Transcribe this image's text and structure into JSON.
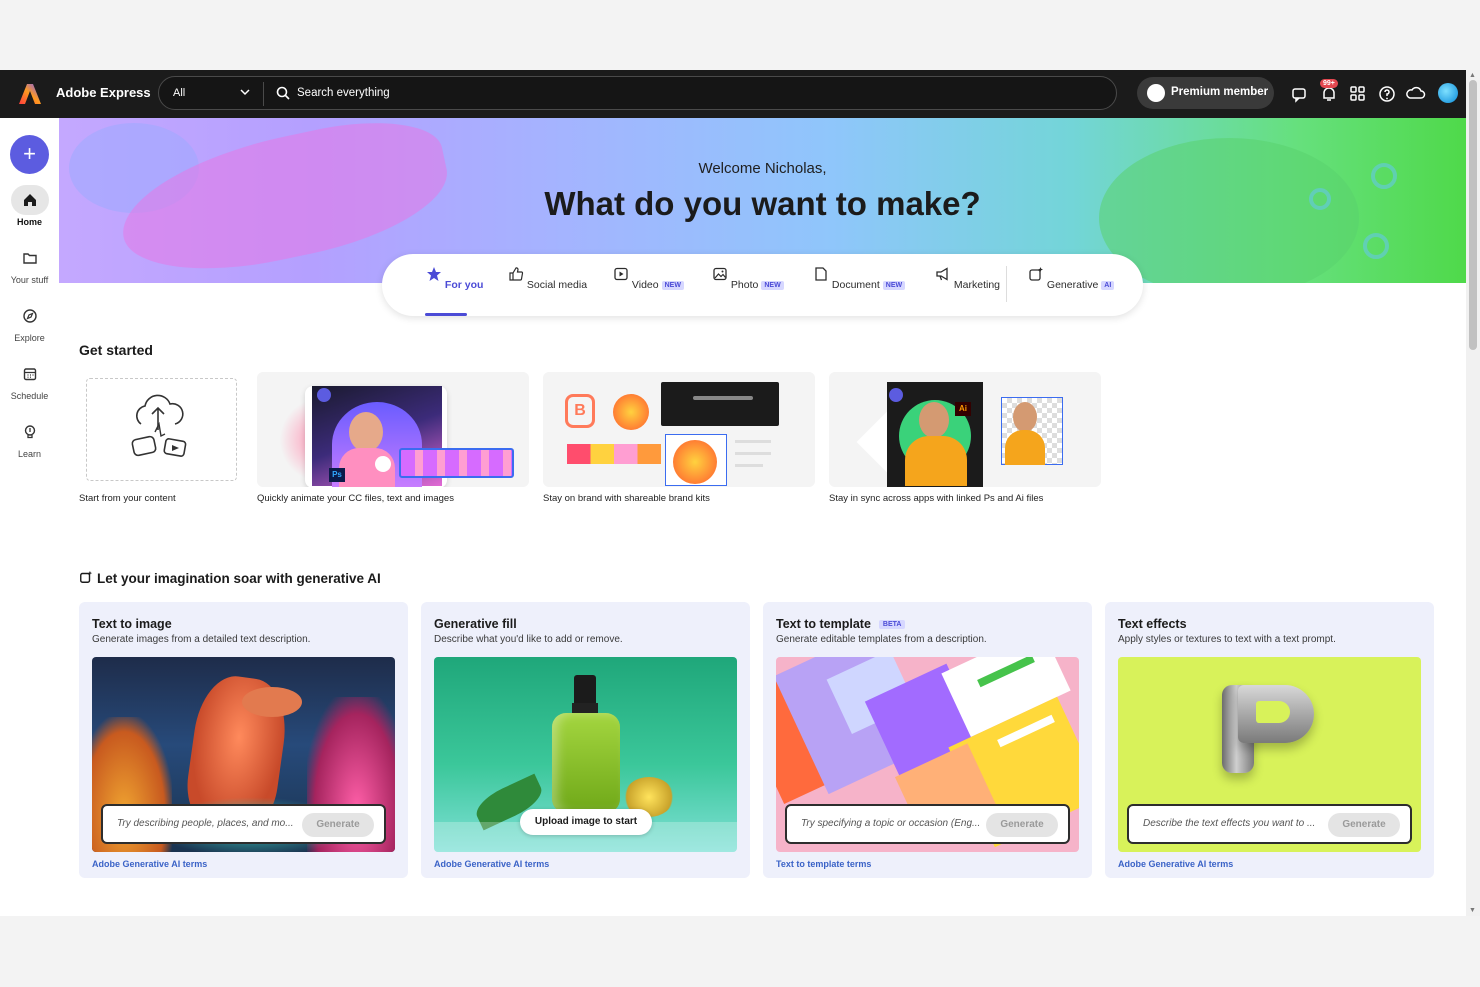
{
  "app": {
    "brand": "Adobe Express"
  },
  "search": {
    "scope": "All",
    "placeholder": "Search everything"
  },
  "header": {
    "premium_label": "Premium member",
    "notification_badge": "99+"
  },
  "rail": {
    "items": [
      {
        "label": "Home",
        "icon": "home-icon",
        "active": true
      },
      {
        "label": "Your stuff",
        "icon": "folder-icon",
        "active": false
      },
      {
        "label": "Explore",
        "icon": "compass-icon",
        "active": false
      },
      {
        "label": "Schedule",
        "icon": "calendar-icon",
        "active": false
      },
      {
        "label": "Learn",
        "icon": "lightbulb-icon",
        "active": false
      }
    ]
  },
  "hero": {
    "welcome": "Welcome Nicholas,",
    "headline": "What do you want to make?"
  },
  "tabs": [
    {
      "label": "For you",
      "badge": "",
      "icon": "star-icon",
      "active": true
    },
    {
      "label": "Social media",
      "badge": "",
      "icon": "thumbs-up-icon"
    },
    {
      "label": "Video",
      "badge": "NEW",
      "icon": "play-icon"
    },
    {
      "label": "Photo",
      "badge": "NEW",
      "icon": "image-icon"
    },
    {
      "label": "Document",
      "badge": "NEW",
      "icon": "document-icon"
    },
    {
      "label": "Marketing",
      "badge": "",
      "icon": "megaphone-icon"
    },
    {
      "label": "Generative",
      "badge": "AI",
      "icon": "generative-ai-icon"
    }
  ],
  "get_started": {
    "title": "Get started",
    "cards": [
      {
        "caption": "Start from your content"
      },
      {
        "caption": "Quickly animate your CC files, text and images"
      },
      {
        "caption": "Stay on brand with shareable brand kits"
      },
      {
        "caption": "Stay in sync across apps with linked Ps and Ai files"
      }
    ]
  },
  "generative": {
    "title": "Let your imagination soar with generative AI",
    "cards": [
      {
        "title": "Text to image",
        "badge": "",
        "description": "Generate images from a detailed text description.",
        "placeholder": "Try describing people, places, and mo...",
        "button": "Generate",
        "terms": "Adobe Generative AI terms"
      },
      {
        "title": "Generative fill",
        "badge": "",
        "description": "Describe what you'd like to add or remove.",
        "button": "Upload image to start",
        "terms": "Adobe Generative AI terms"
      },
      {
        "title": "Text to template",
        "badge": "BETA",
        "description": "Generate editable templates from a description.",
        "placeholder": "Try specifying a topic or occasion (Eng...",
        "button": "Generate",
        "terms": "Text to template terms"
      },
      {
        "title": "Text effects",
        "badge": "",
        "description": "Apply styles or textures to text with a text prompt.",
        "placeholder": "Describe the text effects you want to ...",
        "button": "Generate",
        "terms": "Adobe Generative AI terms"
      }
    ]
  },
  "colors": {
    "accent": "#5c5ce0",
    "topbar": "#1b1b1b",
    "link": "#3b63c7"
  }
}
